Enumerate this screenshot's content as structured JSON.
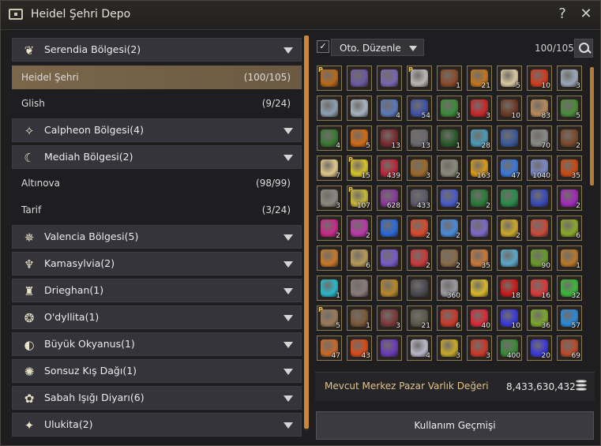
{
  "window": {
    "title": "Heidel Şehri Depo",
    "help_label": "?",
    "close_label": "✕"
  },
  "sidebar": {
    "regions": [
      {
        "label": "Serendia Bölgesi(2)",
        "icon": "serendia-emblem-icon",
        "glyph": "❦"
      },
      {
        "label": "Calpheon Bölgesi(4)",
        "icon": "calpheon-emblem-icon",
        "glyph": "✧"
      },
      {
        "label": "Mediah Bölgesi(2)",
        "icon": "mediah-moon-icon",
        "glyph": "☾"
      },
      {
        "label": "Valencia Bölgesi(5)",
        "icon": "valencia-emblem-icon",
        "glyph": "✵"
      },
      {
        "label": "Kamasylvia(2)",
        "icon": "kamasylvia-emblem-icon",
        "glyph": "♆"
      },
      {
        "label": "Drieghan(1)",
        "icon": "drieghan-emblem-icon",
        "glyph": "♜"
      },
      {
        "label": "O'dyllita(1)",
        "icon": "odyllita-emblem-icon",
        "glyph": "❂"
      },
      {
        "label": "Büyük Okyanus(1)",
        "icon": "ocean-emblem-icon",
        "glyph": "◐"
      },
      {
        "label": "Sonsuz Kış Dağı(1)",
        "icon": "winter-mountain-icon",
        "glyph": "✺"
      },
      {
        "label": "Sabah Işığı Diyarı(6)",
        "icon": "morning-land-icon",
        "glyph": "✿"
      },
      {
        "label": "Ulukita(2)",
        "icon": "ulukita-emblem-icon",
        "glyph": "✦"
      }
    ],
    "cities": [
      {
        "name": "Heidel Şehri",
        "count": "(100/105)",
        "selected": true
      },
      {
        "name": "Glish",
        "count": "(9/24)"
      },
      {
        "name": "Altınova",
        "count": "(98/99)"
      },
      {
        "name": "Tarif",
        "count": "(3/24)"
      }
    ]
  },
  "storage": {
    "sort_checkbox": "✓",
    "sort_label": "Oto. Düzenle",
    "capacity": "100/105",
    "items": [
      {
        "qty": "",
        "p": "P",
        "color": "#b86a1a",
        "icon": "pumpkin-item-icon"
      },
      {
        "qty": "",
        "color": "#6b5aa0",
        "icon": "book-item-icon"
      },
      {
        "qty": "",
        "color": "#7a66b0",
        "icon": "book-item-icon"
      },
      {
        "qty": "",
        "p": "P",
        "color": "#b8b8b8",
        "icon": "horse-item-icon"
      },
      {
        "qty": "1",
        "color": "#8a4b2a",
        "icon": "scroll-item-icon"
      },
      {
        "qty": "21",
        "color": "#c2761e",
        "icon": "food-item-icon"
      },
      {
        "qty": "5",
        "color": "#d8c9a0",
        "icon": "dish-item-icon"
      },
      {
        "qty": "10",
        "color": "#d13b1e",
        "icon": "potion-item-icon"
      },
      {
        "qty": "3",
        "color": "#9aa8b8",
        "icon": "ring-item-icon"
      },
      {
        "qty": "",
        "color": "#8ca0b0",
        "icon": "ring-item-icon"
      },
      {
        "qty": "",
        "color": "#a6b4c0",
        "icon": "ring-item-icon"
      },
      {
        "qty": "4",
        "color": "#5a78b8",
        "icon": "vase-item-icon"
      },
      {
        "qty": "54",
        "color": "#3f52a8",
        "icon": "orb-item-icon"
      },
      {
        "qty": "3",
        "color": "#3c8a3a",
        "icon": "gem-item-icon"
      },
      {
        "qty": "3",
        "color": "#c8282a",
        "icon": "rose-item-icon"
      },
      {
        "qty": "10",
        "color": "#6b3a24",
        "icon": "chocolate-item-icon"
      },
      {
        "qty": "83",
        "color": "#b8895a",
        "icon": "tea-item-icon"
      },
      {
        "qty": "5",
        "color": "#4a8a3a",
        "icon": "plant-item-icon"
      },
      {
        "qty": "4",
        "color": "#3a7a32",
        "icon": "herb-item-icon"
      },
      {
        "qty": "5",
        "color": "#d06a14",
        "icon": "pumpkin-item-icon"
      },
      {
        "qty": "13",
        "color": "#7a2a30",
        "icon": "claw-item-icon"
      },
      {
        "qty": "13",
        "color": "#6a6a70",
        "icon": "claw-item-icon"
      },
      {
        "qty": "1",
        "color": "#2a5a2a",
        "icon": "blade-item-icon"
      },
      {
        "qty": "28",
        "color": "#4a9ab8",
        "icon": "tail-item-icon"
      },
      {
        "qty": "",
        "color": "#3a5a9a",
        "icon": "chest-item-icon"
      },
      {
        "qty": "70",
        "color": "#8a8a88",
        "icon": "lantern-item-icon"
      },
      {
        "qty": "2",
        "color": "#7a4a2a",
        "icon": "chest-item-icon"
      },
      {
        "qty": "7",
        "color": "#e0c88a",
        "icon": "bottle-item-icon"
      },
      {
        "qty": "15",
        "p": "P",
        "color": "#d8c22a",
        "icon": "elixir-item-icon"
      },
      {
        "qty": "439",
        "color": "#b8283a",
        "icon": "ore-item-icon"
      },
      {
        "qty": "3",
        "color": "#9a6a2a",
        "icon": "box-item-icon"
      },
      {
        "qty": "2",
        "color": "#8a8a7a",
        "icon": "feather-item-icon"
      },
      {
        "qty": "163",
        "color": "#d89a1a",
        "icon": "scroll-item-icon"
      },
      {
        "qty": "47",
        "color": "#3a78d8",
        "icon": "scale-item-icon"
      },
      {
        "qty": "1040",
        "color": "#7a8ac8",
        "icon": "shard-item-icon"
      },
      {
        "qty": "35",
        "color": "#c84a14",
        "icon": "flower-item-icon"
      },
      {
        "qty": "3",
        "color": "#8a8a80",
        "icon": "feather-item-icon"
      },
      {
        "qty": "107",
        "p": "P",
        "color": "#c8b83a",
        "icon": "flask-item-icon"
      },
      {
        "qty": "628",
        "color": "#8a3a9a",
        "icon": "crystal-item-icon"
      },
      {
        "qty": "433",
        "color": "#5a5a6a",
        "icon": "bottle-item-icon"
      },
      {
        "qty": "2",
        "color": "#4a5ac8",
        "icon": "crystal-item-icon"
      },
      {
        "qty": "2",
        "color": "#2a7a3a",
        "icon": "vine-item-icon"
      },
      {
        "qty": "",
        "color": "#2a8a4a",
        "icon": "vine-item-icon"
      },
      {
        "qty": "",
        "color": "#3a4ab8",
        "icon": "gem-item-icon"
      },
      {
        "qty": "2",
        "color": "#a02ab8",
        "icon": "gem-item-icon"
      },
      {
        "qty": "2",
        "color": "#c82a8a",
        "icon": "crystal-item-icon"
      },
      {
        "qty": "2",
        "color": "#b83aa8",
        "icon": "crystal-item-icon"
      },
      {
        "qty": "",
        "color": "#2a6ad8",
        "icon": "crystal-item-icon"
      },
      {
        "qty": "2",
        "color": "#d84a2a",
        "icon": "crystal-item-icon"
      },
      {
        "qty": "2",
        "color": "#4a8ad8",
        "icon": "crystal-item-icon"
      },
      {
        "qty": "",
        "color": "#7a6ac8",
        "icon": "crystal-item-icon"
      },
      {
        "qty": "2",
        "color": "#c8a82a",
        "icon": "crystal-item-icon"
      },
      {
        "qty": "",
        "color": "#c84a3a",
        "icon": "star-item-icon"
      },
      {
        "qty": "6",
        "color": "#8aa82a",
        "icon": "shard-item-icon"
      },
      {
        "qty": "",
        "color": "#c8782a",
        "icon": "stone-item-icon"
      },
      {
        "qty": "6",
        "color": "#b89a5a",
        "icon": "stone-item-icon"
      },
      {
        "qty": "",
        "color": "#7a5ac8",
        "icon": "rune-item-icon"
      },
      {
        "qty": "2",
        "color": "#c83a3a",
        "icon": "ore-item-icon"
      },
      {
        "qty": "2",
        "color": "#8a6a4a",
        "icon": "branch-item-icon"
      },
      {
        "qty": "35",
        "color": "#c8783a",
        "icon": "ore-item-icon"
      },
      {
        "qty": "",
        "color": "#5aa8c8",
        "icon": "crystal-item-icon"
      },
      {
        "qty": "90",
        "color": "#6a9a2a",
        "icon": "root-item-icon"
      },
      {
        "qty": "1",
        "color": "#b8782a",
        "icon": "gear-item-icon"
      },
      {
        "qty": "1",
        "color": "#2ab8c8",
        "icon": "orb-item-icon"
      },
      {
        "qty": "",
        "color": "#8a7a7a",
        "icon": "card-item-icon"
      },
      {
        "qty": "",
        "color": "#b8882a",
        "icon": "key-item-icon"
      },
      {
        "qty": "",
        "color": "#4a4a52",
        "icon": "stone-item-icon"
      },
      {
        "qty": "360",
        "color": "#9a9aa0",
        "icon": "ore-item-icon"
      },
      {
        "qty": "",
        "color": "#d8b82a",
        "icon": "horn-item-icon"
      },
      {
        "qty": "18",
        "color": "#c81a1a",
        "icon": "orb-item-icon"
      },
      {
        "qty": "16",
        "color": "#d83a3a",
        "icon": "orb-item-icon"
      },
      {
        "qty": "32",
        "color": "#3ab83a",
        "icon": "orb-item-icon"
      },
      {
        "qty": "5",
        "p": "P",
        "color": "#9a7a5a",
        "icon": "card-item-icon"
      },
      {
        "qty": "1",
        "color": "#7a5a3a",
        "icon": "scroll-item-icon"
      },
      {
        "qty": "3",
        "color": "#7a3a3a",
        "icon": "book-item-icon"
      },
      {
        "qty": "21",
        "color": "#5a5a4a",
        "icon": "tool-item-icon"
      },
      {
        "qty": "6",
        "color": "#c83a2a",
        "icon": "ore-item-icon"
      },
      {
        "qty": "40",
        "color": "#d82a3a",
        "icon": "crystal-item-icon"
      },
      {
        "qty": "10",
        "color": "#3a3ad8",
        "icon": "crystal-item-icon"
      },
      {
        "qty": "36",
        "color": "#7aa82a",
        "icon": "leaf-item-icon"
      },
      {
        "qty": "57",
        "color": "#2a8ad8",
        "icon": "orb-item-icon"
      },
      {
        "qty": "47",
        "color": "#c86a2a",
        "icon": "orb-item-icon"
      },
      {
        "qty": "43",
        "color": "#d84a1a",
        "icon": "orb-item-icon"
      },
      {
        "qty": "",
        "color": "#6a3ab8",
        "icon": "flower-item-icon"
      },
      {
        "qty": "4",
        "color": "#b8b8c8",
        "icon": "orb-item-icon"
      },
      {
        "qty": "3",
        "color": "#c8a82a",
        "icon": "chest-item-icon"
      },
      {
        "qty": "3",
        "color": "#c83a2a",
        "icon": "chest-item-icon"
      },
      {
        "qty": "400",
        "color": "#3a8a3a",
        "icon": "leaf-item-icon"
      },
      {
        "qty": "20",
        "color": "#3a3ad8",
        "icon": "flower-item-icon"
      },
      {
        "qty": "69",
        "color": "#b84a2a",
        "icon": "horn-item-icon"
      }
    ]
  },
  "footer": {
    "value_label": "Mevcut Merkez Pazar Varlık Değeri",
    "value_amount": "8,433,630,432",
    "history_button": "Kullanım Geçmişi"
  },
  "colors": {
    "accent": "#c9863c",
    "selected_row": "#7b664a",
    "slot_border": "#8a7a52"
  }
}
